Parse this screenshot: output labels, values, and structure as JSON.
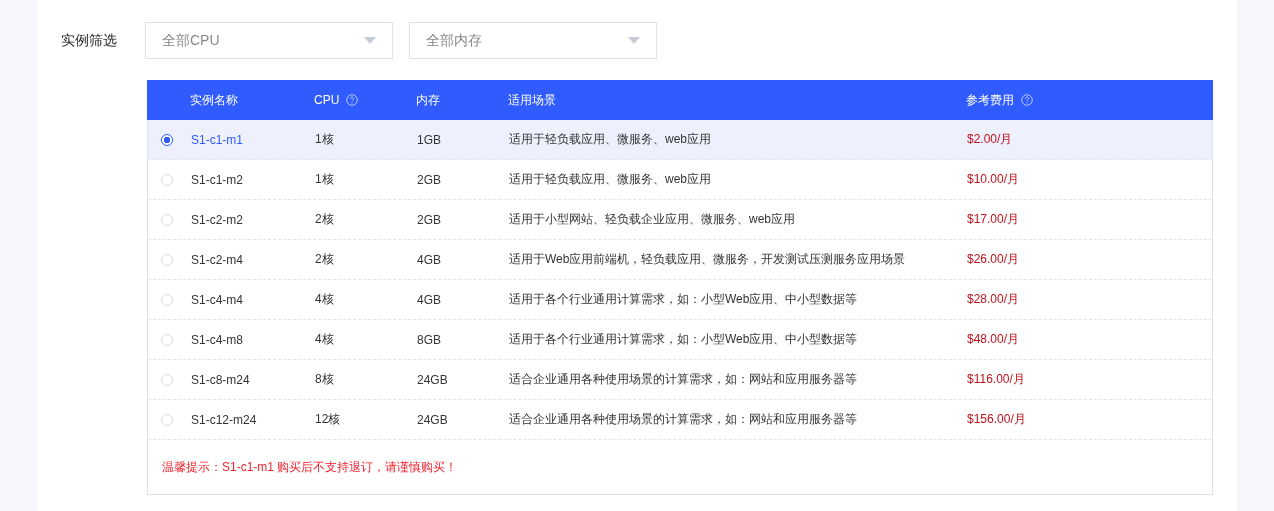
{
  "filter": {
    "label": "实例筛选",
    "dropdowns": [
      {
        "placeholder": "全部CPU"
      },
      {
        "placeholder": "全部内存"
      }
    ]
  },
  "table": {
    "columns": [
      {
        "label": "实例名称",
        "help": false
      },
      {
        "label": "CPU",
        "help": true
      },
      {
        "label": "内存",
        "help": false
      },
      {
        "label": "适用场景",
        "help": false
      },
      {
        "label": "参考费用",
        "help": true
      }
    ],
    "rows": [
      {
        "selected": true,
        "name": "S1-c1-m1",
        "cpu": "1核",
        "memory": "1GB",
        "scene": "适用于轻负载应用、微服务、web应用",
        "price": "$2.00/月"
      },
      {
        "selected": false,
        "name": "S1-c1-m2",
        "cpu": "1核",
        "memory": "2GB",
        "scene": "适用于轻负载应用、微服务、web应用",
        "price": "$10.00/月"
      },
      {
        "selected": false,
        "name": "S1-c2-m2",
        "cpu": "2核",
        "memory": "2GB",
        "scene": "适用于小型网站、轻负载企业应用、微服务、web应用",
        "price": "$17.00/月"
      },
      {
        "selected": false,
        "name": "S1-c2-m4",
        "cpu": "2核",
        "memory": "4GB",
        "scene": "适用于Web应用前端机，轻负载应用、微服务，开发测试压测服务应用场景",
        "price": "$26.00/月"
      },
      {
        "selected": false,
        "name": "S1-c4-m4",
        "cpu": "4核",
        "memory": "4GB",
        "scene": "适用于各个行业通用计算需求，如：小型Web应用、中小型数据等",
        "price": "$28.00/月"
      },
      {
        "selected": false,
        "name": "S1-c4-m8",
        "cpu": "4核",
        "memory": "8GB",
        "scene": "适用于各个行业通用计算需求，如：小型Web应用、中小型数据等",
        "price": "$48.00/月"
      },
      {
        "selected": false,
        "name": "S1-c8-m24",
        "cpu": "8核",
        "memory": "24GB",
        "scene": "适合企业通用各种使用场景的计算需求，如：网站和应用服务器等",
        "price": "$116.00/月"
      },
      {
        "selected": false,
        "name": "S1-c12-m24",
        "cpu": "12核",
        "memory": "24GB",
        "scene": "适合企业通用各种使用场景的计算需求，如：网站和应用服务器等",
        "price": "$156.00/月"
      }
    ],
    "notice": "温馨提示：S1-c1-m1 购买后不支持退订，请谨慎购买！"
  }
}
